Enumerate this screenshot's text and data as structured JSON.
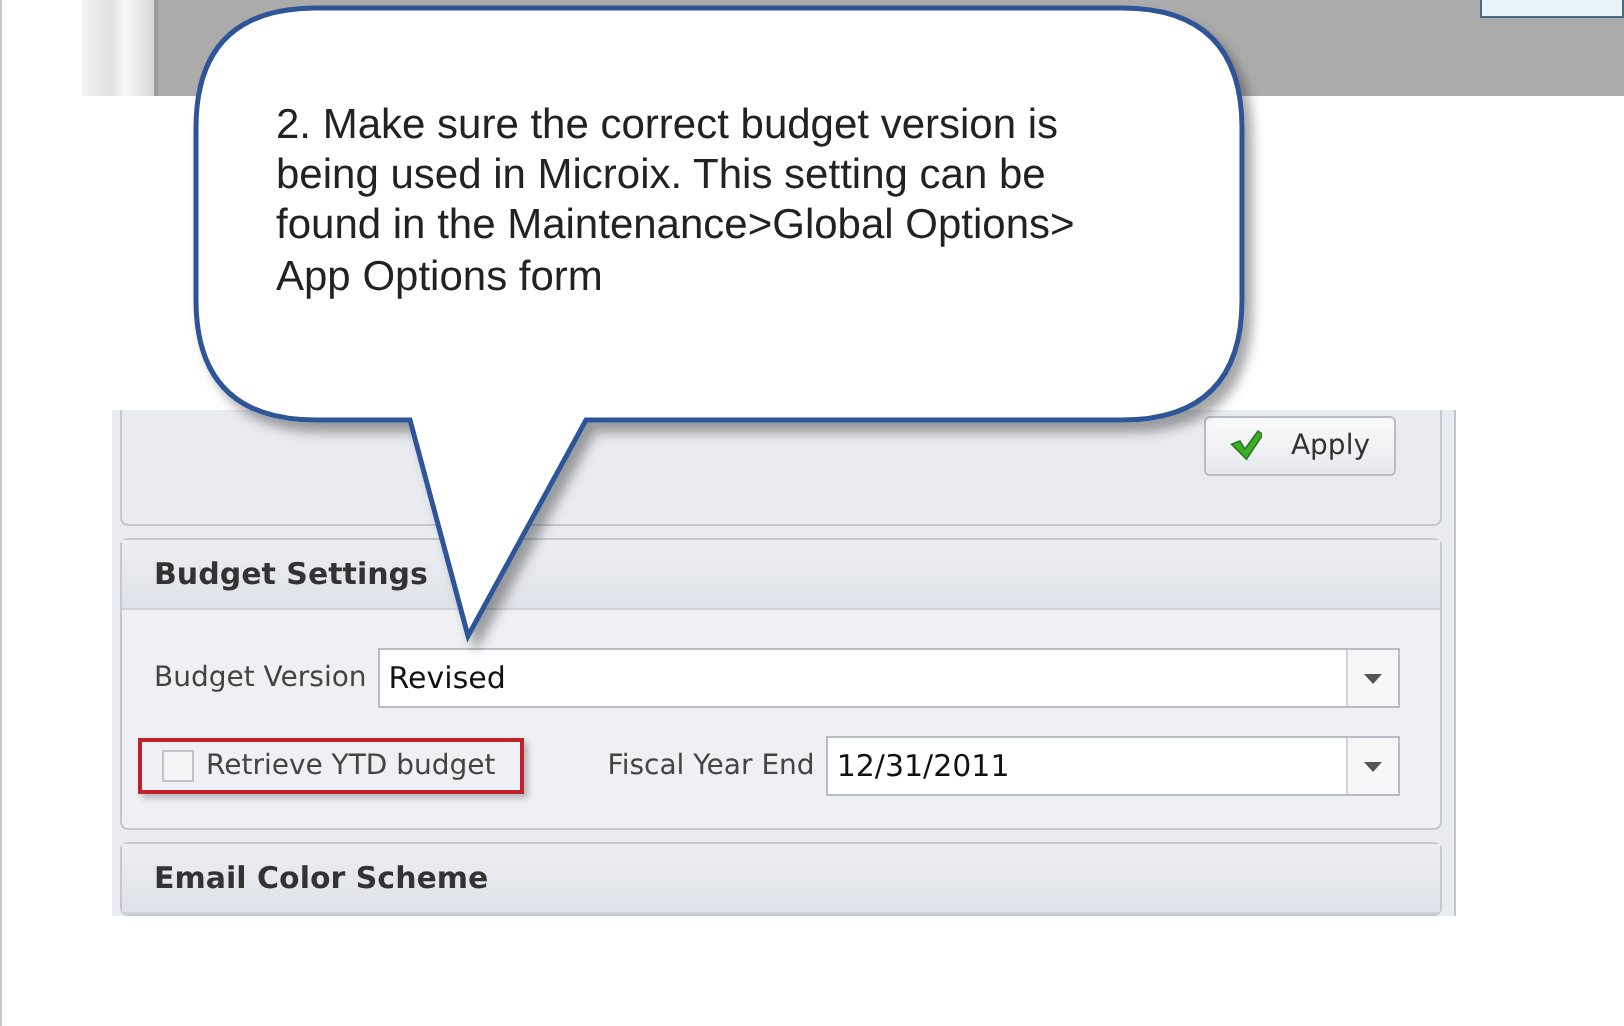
{
  "callout": {
    "lines": [
      "2. Make sure the correct budget version is",
      "being used in Microix. This setting can be",
      "found in the Maintenance>Global Options>",
      "App Options form"
    ]
  },
  "apply_button": {
    "label": "Apply"
  },
  "budget_settings": {
    "title": "Budget Settings",
    "budget_version": {
      "label": "Budget Version",
      "value": "Revised"
    },
    "retrieve_ytd": {
      "label": "Retrieve YTD budget",
      "checked": false,
      "highlighted": true
    },
    "fiscal_year_end": {
      "label": "Fiscal Year End",
      "value": "12/31/2011"
    }
  },
  "email_color_scheme": {
    "title": "Email Color Scheme"
  }
}
